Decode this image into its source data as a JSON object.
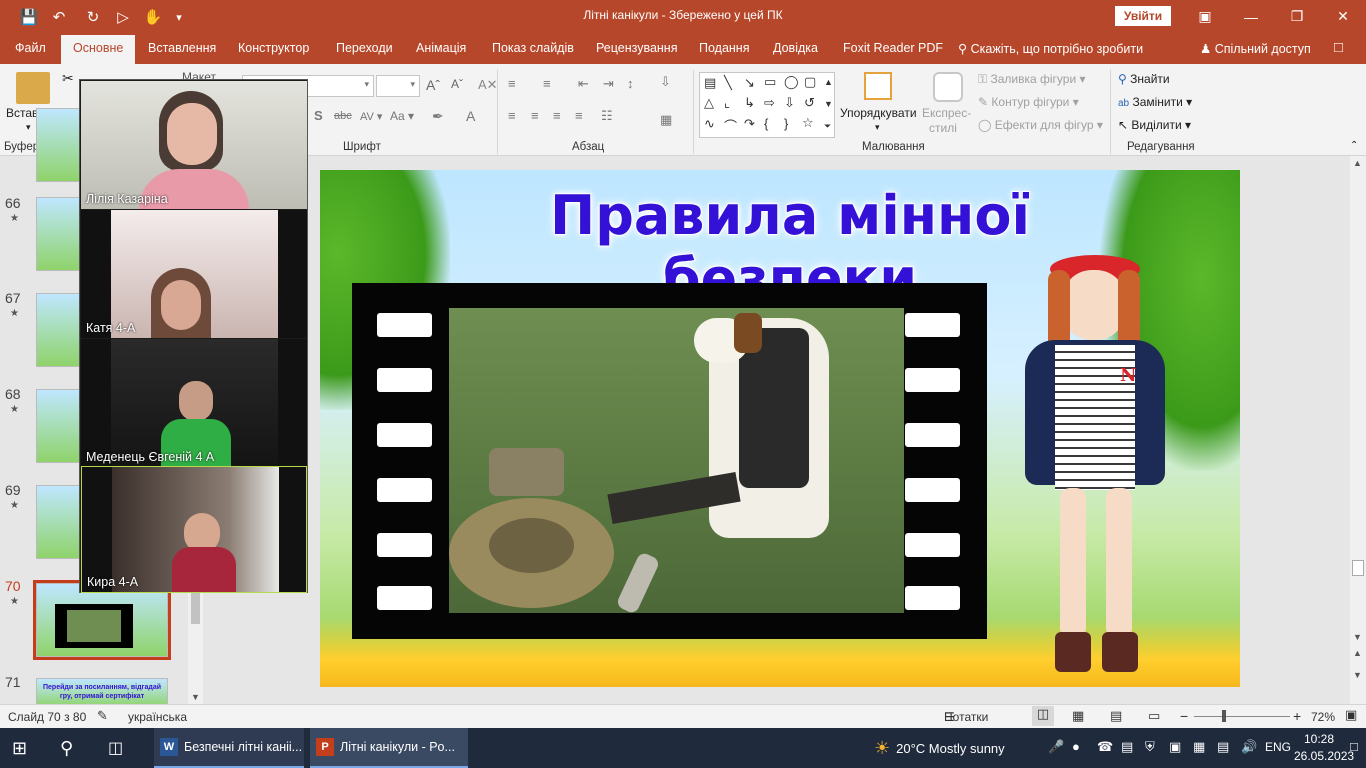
{
  "titlebar": {
    "title": "Літні канікули  -  Збережено у цей ПК",
    "signin_label": "Увійти",
    "icons": [
      "save-icon",
      "undo-icon",
      "redo-icon",
      "start-from-beginning-icon",
      "touch-mode-icon",
      "customize-qa-icon"
    ],
    "window_buttons": [
      "ribbon-display-icon",
      "minimize-icon",
      "restore-icon",
      "close-icon"
    ]
  },
  "menu": {
    "tabs": [
      "Файл",
      "Основне",
      "Вставлення",
      "Конструктор",
      "Переходи",
      "Анімація",
      "Показ слайдів",
      "Рецензування",
      "Подання",
      "Довідка",
      "Foxit Reader PDF"
    ],
    "active_tab": 1,
    "tell_me": "Скажіть, що потрібно зробити",
    "share": "Спільний доступ"
  },
  "ribbon": {
    "clipboard": {
      "paste": "Вставити",
      "group": "Буфер обміну",
      "partial_label": "Макет"
    },
    "font": {
      "group": "Шрифт"
    },
    "paragraph": {
      "group": "Абзац"
    },
    "drawing": {
      "group": "Малювання",
      "arrange": "Упорядкувати",
      "quick_styles_1": "Експрес-",
      "quick_styles_2": "стилі",
      "shape_fill": "Заливка фігури",
      "shape_outline": "Контур фігури",
      "shape_effects": "Ефекти для фігур"
    },
    "editing": {
      "group": "Редагування",
      "find": "Знайти",
      "replace": "Замінити",
      "select": "Виділити"
    }
  },
  "thumbnails": [
    {
      "num": "66"
    },
    {
      "num": "67"
    },
    {
      "num": "68"
    },
    {
      "num": "69"
    },
    {
      "num": "70",
      "selected": true
    },
    {
      "num": "71",
      "caption": "Перейди за посиланням, відгадай гру, отримай сертифікат"
    }
  ],
  "video_tiles": [
    {
      "name": "Лілія Казаріна"
    },
    {
      "name": "Катя  4-А"
    },
    {
      "name": "Меденець Євгеній 4 А"
    },
    {
      "name": "Кира 4-А"
    }
  ],
  "slide": {
    "title": "Правила мінної безпеки",
    "badge_letter": "N"
  },
  "statusbar": {
    "slide_counter": "Слайд 70 з 80",
    "language": "українська",
    "notes": "Нотатки",
    "zoom": "72%"
  },
  "taskbar": {
    "apps": [
      {
        "icon": "word-icon",
        "label": "Безпечні літні каніі..."
      },
      {
        "icon": "powerpoint-icon",
        "label": "Літні канікули - Po..."
      }
    ],
    "weather": "20°C  Mostly sunny",
    "lang": "ENG",
    "time": "10:28",
    "date": "26.05.2023"
  },
  "colors": {
    "accent": "#b7472a",
    "taskbar": "#1f2a3d",
    "slide_title": "#3411d6"
  }
}
